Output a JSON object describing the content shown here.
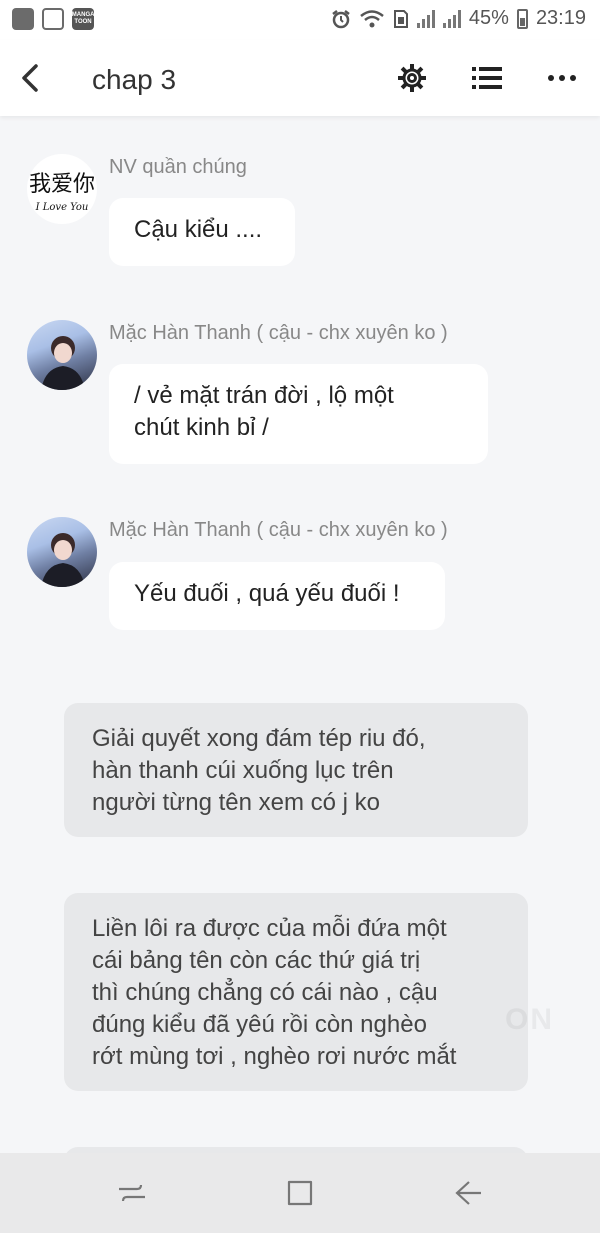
{
  "status_bar": {
    "manga_icon_text": "MANGA TOON",
    "battery": "45%",
    "time": "23:19"
  },
  "header": {
    "title": "chap 3"
  },
  "messages": [
    {
      "sender": "NV quần chúng",
      "avatar_text_cn": "我爱你",
      "avatar_text_en": "I Love You",
      "text": "Cậu kiểu ...."
    },
    {
      "sender": "Mặc Hàn Thanh ( cậu - chx xuyên ko )",
      "text_line1": "/ vẻ mặt trán đời , lộ một",
      "text_line2": "chút kinh bỉ /"
    },
    {
      "sender": "Mặc Hàn Thanh ( cậu - chx xuyên ko )",
      "text": "Yếu đuối , quá yếu đuối !"
    }
  ],
  "narrations": [
    {
      "lines": [
        "Giải quyết xong đám tép riu đó,",
        "hàn thanh cúi xuống lục trên",
        "người từng tên xem có j ko"
      ]
    },
    {
      "lines": [
        "Liền lôi ra được của mỗi đứa một",
        "cái bảng tên còn các thứ giá trị",
        "thì chúng chẳng có cái nào , cậu",
        "đúng kiểu đã yêú rồi còn nghèo",
        "rớt mùng tơi , nghèo rơi nước mắt"
      ]
    }
  ],
  "watermark": "ON",
  "icons": {
    "back": "back-arrow-icon",
    "settings": "gear-icon",
    "list": "list-icon",
    "more": "more-dots-icon",
    "recent": "recent-apps-icon",
    "home": "home-icon",
    "nav_back": "nav-back-icon"
  }
}
